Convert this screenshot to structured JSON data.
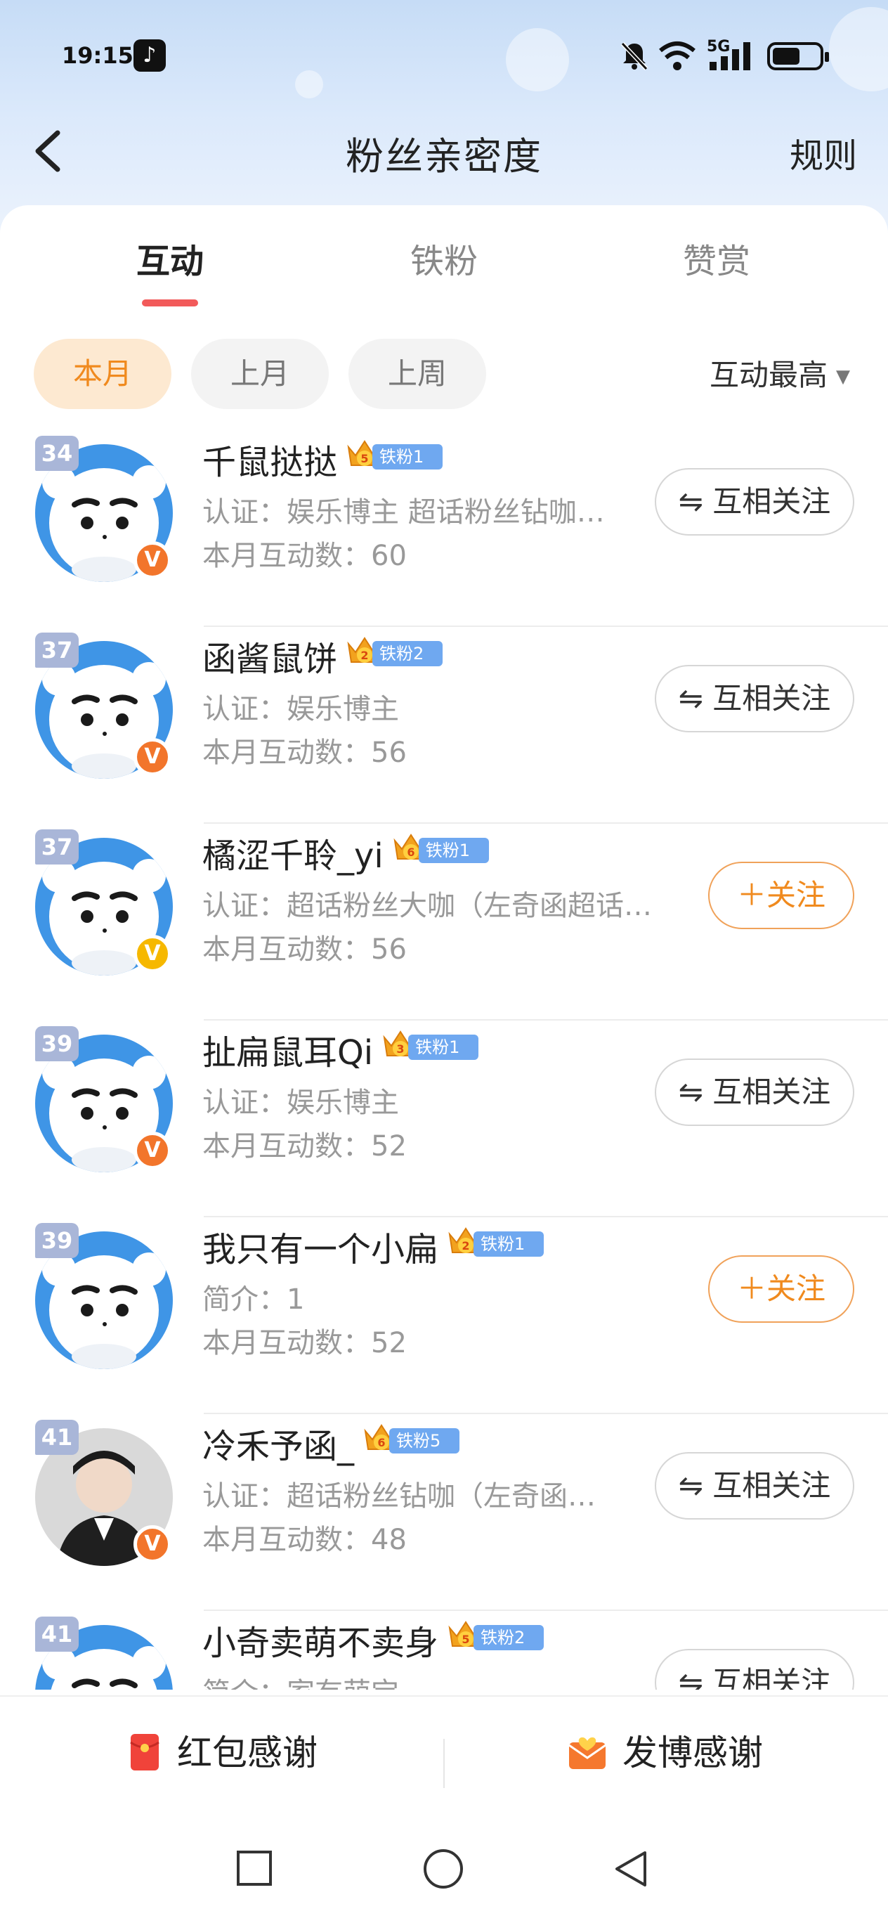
{
  "status_bar": {
    "time": "19:15",
    "network": "5G"
  },
  "header": {
    "title": "粉丝亲密度",
    "rules_label": "规则"
  },
  "tabs": [
    {
      "label": "互动"
    },
    {
      "label": "铁粉"
    },
    {
      "label": "赞赏"
    }
  ],
  "filters": [
    {
      "label": "本月"
    },
    {
      "label": "上月"
    },
    {
      "label": "上周"
    }
  ],
  "sort_label": "互动最高",
  "fans": [
    {
      "rank": "34",
      "name": "千鼠挞挞",
      "crown_level": "5",
      "fan_tag": "铁粉1",
      "desc": "认证：娱乐博主 超话粉丝钻咖…",
      "interactions": "本月互动数：60",
      "button": "⇋ 互相关注",
      "verify": "orange"
    },
    {
      "rank": "37",
      "name": "函酱鼠饼",
      "crown_level": "2",
      "fan_tag": "铁粉2",
      "desc": "认证：娱乐博主",
      "interactions": "本月互动数：56",
      "button": "⇋ 互相关注",
      "verify": "orange"
    },
    {
      "rank": "37",
      "name": "橘涩千聆_yi",
      "crown_level": "6",
      "fan_tag": "铁粉1",
      "desc": "认证：超话粉丝大咖（左奇函超话…",
      "interactions": "本月互动数：56",
      "button": "＋关注",
      "verify": "yellow"
    },
    {
      "rank": "39",
      "name": "扯扁鼠耳Qi",
      "crown_level": "3",
      "fan_tag": "铁粉1",
      "desc": "认证：娱乐博主",
      "interactions": "本月互动数：52",
      "button": "⇋ 互相关注",
      "verify": "orange"
    },
    {
      "rank": "39",
      "name": "我只有一个小扁",
      "crown_level": "2",
      "fan_tag": "铁粉1",
      "desc": "简介：1",
      "interactions": "本月互动数：52",
      "button": "＋关注",
      "verify": "none"
    },
    {
      "rank": "41",
      "name": "冷禾予函_",
      "crown_level": "6",
      "fan_tag": "铁粉5",
      "desc": "认证：超话粉丝钻咖（左奇函…",
      "interactions": "本月互动数：48",
      "button": "⇋ 互相关注",
      "verify": "orange"
    },
    {
      "rank": "41",
      "name": "小奇卖萌不卖身",
      "crown_level": "5",
      "fan_tag": "铁粉2",
      "desc": "简介：家有萌宝",
      "interactions": "",
      "button": "⇋ 互相关注",
      "verify": "none"
    }
  ],
  "bottom_bar": {
    "left_label": "红包感谢",
    "right_label": "发博感谢"
  },
  "colors": {
    "accent": "#f08a1e",
    "tab_underline": "#f25a5a",
    "fan_tag": "#6fa8f0",
    "rank_badge": "#a9b6d8"
  }
}
